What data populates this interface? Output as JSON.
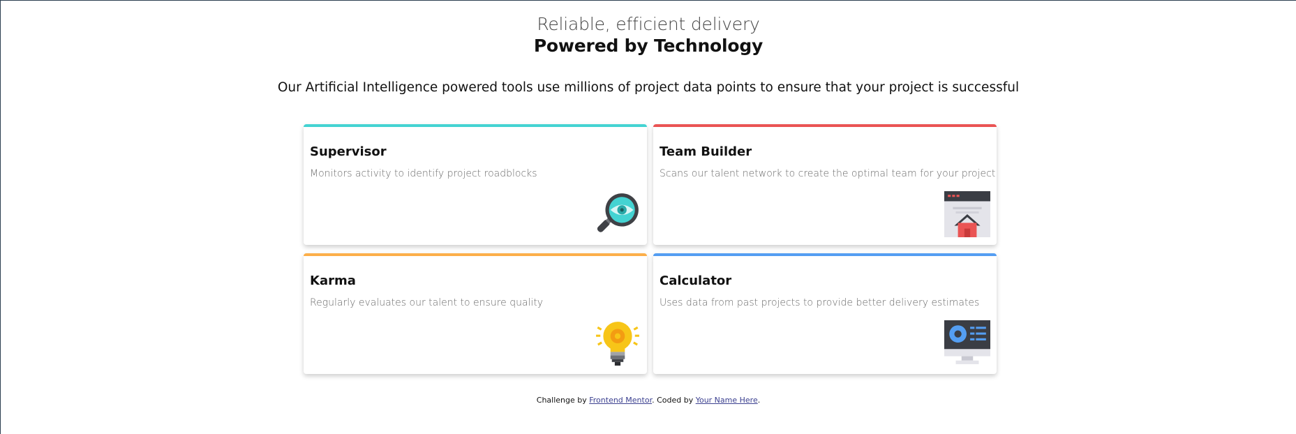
{
  "header": {
    "subtitle": "Reliable, efficient delivery",
    "title": "Powered by Technology"
  },
  "intro": "Our Artificial Intelligence powered tools use millions of project data points to ensure that your project is successful",
  "cards": [
    {
      "title": "Supervisor",
      "description": "Monitors activity to identify project roadblocks",
      "accent_color": "#44d3d2",
      "icon": "supervisor-icon"
    },
    {
      "title": "Team Builder",
      "description": "Scans our talent network to create the optimal team for your project",
      "accent_color": "#ea5454",
      "icon": "team-builder-icon"
    },
    {
      "title": "Karma",
      "description": "Regularly evaluates our talent to ensure quality",
      "accent_color": "#fcaf4a",
      "icon": "karma-icon"
    },
    {
      "title": "Calculator",
      "description": "Uses data from past projects to provide better delivery estimates",
      "accent_color": "#549ef2",
      "icon": "calculator-icon"
    }
  ],
  "footer": {
    "prefix": "Challenge by",
    "link1": "Frontend Mentor",
    "middle": ". Coded by",
    "link2": "Your Name Here",
    "suffix": "."
  }
}
